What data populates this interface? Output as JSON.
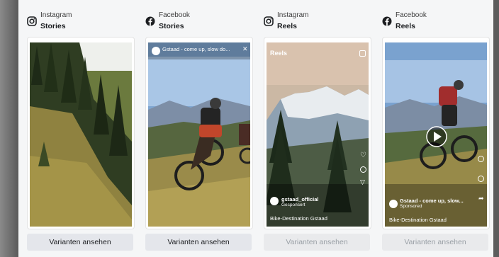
{
  "placements": [
    {
      "platform": "Instagram",
      "placement": "Stories",
      "icon": "instagram-icon",
      "button": "Varianten ansehen",
      "enabled": true
    },
    {
      "platform": "Facebook",
      "placement": "Stories",
      "icon": "facebook-icon",
      "button": "Varianten ansehen",
      "enabled": true
    },
    {
      "platform": "Instagram",
      "placement": "Reels",
      "icon": "instagram-icon",
      "button": "Varianten ansehen",
      "enabled": false
    },
    {
      "platform": "Facebook",
      "placement": "Reels",
      "icon": "facebook-icon",
      "button": "Varianten ansehen",
      "enabled": false
    }
  ],
  "previews": {
    "fb_stories": {
      "caption": "Gstaad - come up, slow do..."
    },
    "ig_reels": {
      "header": "Reels",
      "account": "gstaad_official",
      "sponsored": "Gesponsert",
      "tagline": "Bike-Destination Gstaad"
    },
    "fb_reels": {
      "caption": "Gstaad - come up, slow...",
      "sponsored": "Sponsored",
      "tagline": "Bike-Destination Gstaad"
    }
  },
  "colors": {
    "panel": "#f5f6f7",
    "button": "#e4e6eb",
    "frame": "#6e6e6e"
  }
}
